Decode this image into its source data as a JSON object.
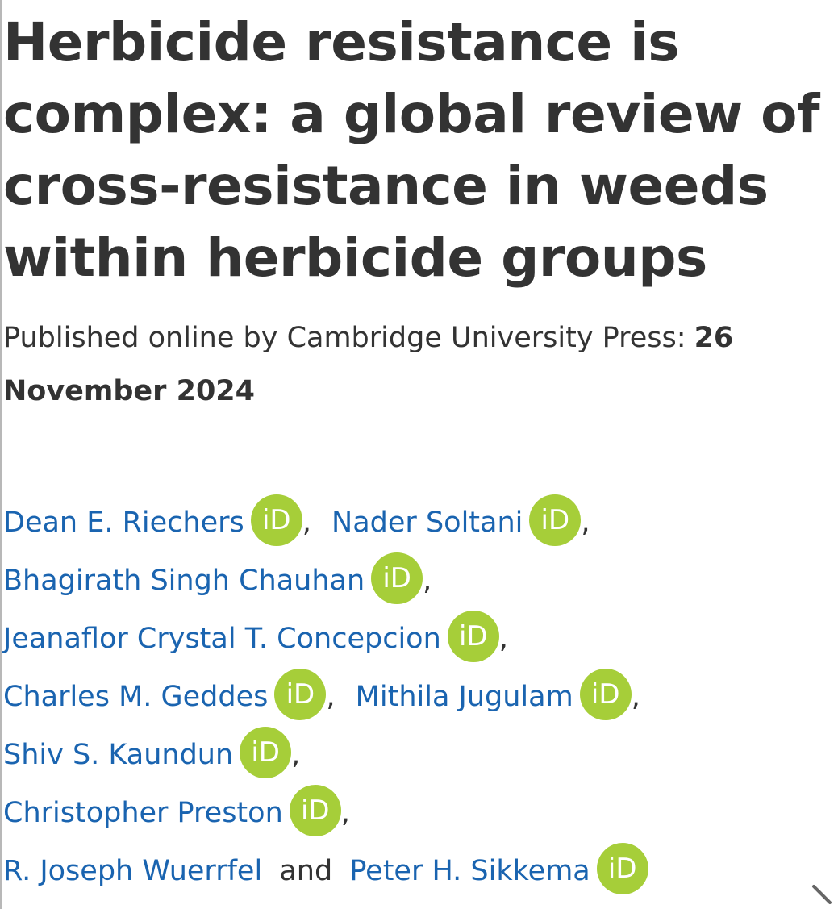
{
  "article": {
    "title": "Herbicide resistance is complex: a global review of cross-resistance in weeds within herbicide groups",
    "published_prefix": "Published online by Cambridge University Press:",
    "published_date": "26 November 2024"
  },
  "authors": [
    {
      "name": "Dean E. Riechers",
      "orcid": "iD",
      "sep": ","
    },
    {
      "name": "Nader Soltani",
      "orcid": "iD",
      "sep": ","
    },
    {
      "name": "Bhagirath Singh Chauhan",
      "orcid": "iD",
      "sep": ","
    },
    {
      "name": "Jeanaflor Crystal T. Concepcion",
      "orcid": "iD",
      "sep": ","
    },
    {
      "name": "Charles M. Geddes",
      "orcid": "iD",
      "sep": ","
    },
    {
      "name": "Mithila Jugulam",
      "orcid": "iD",
      "sep": ","
    },
    {
      "name": "Shiv S. Kaundun",
      "orcid": "iD",
      "sep": ","
    },
    {
      "name": "Christopher Preston",
      "orcid": "iD",
      "sep": ","
    },
    {
      "name": "R. Joseph Wuerrfel"
    },
    {
      "name": "Peter H. Sikkema",
      "orcid": "iD"
    }
  ],
  "conjunction": "and",
  "colors": {
    "link": "#1a64b0",
    "text": "#333333",
    "orcid_badge": "#a6ce39"
  },
  "icons": {
    "orcid": "orcid-icon",
    "resize": "resize-handle-icon"
  }
}
